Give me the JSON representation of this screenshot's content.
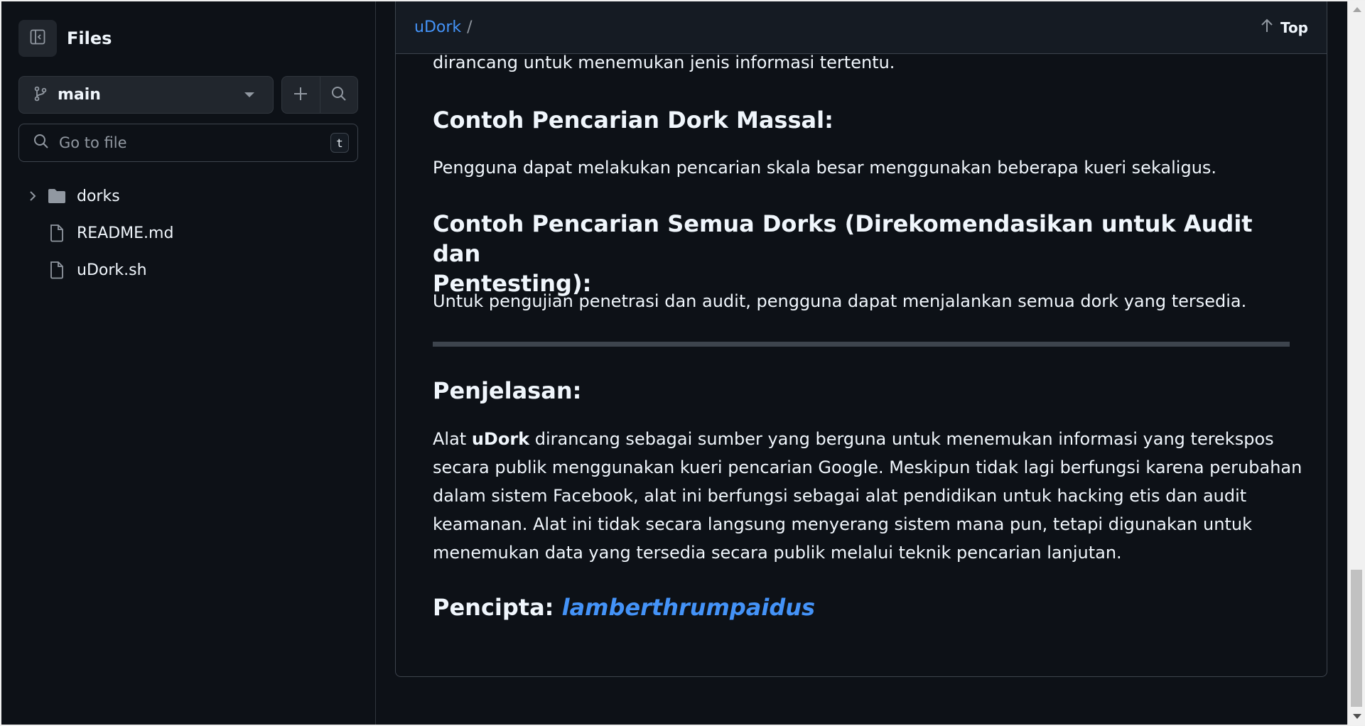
{
  "sidebar": {
    "title": "Files",
    "branch": "main",
    "search_placeholder": "Go to file",
    "search_shortcut": "t",
    "tree": [
      {
        "type": "folder",
        "name": "dorks"
      },
      {
        "type": "file",
        "name": "README.md"
      },
      {
        "type": "file",
        "name": "uDork.sh"
      }
    ]
  },
  "header": {
    "breadcrumb_repo": "uDork",
    "breadcrumb_sep": "/",
    "top_label": "Top"
  },
  "content": {
    "intro_tail": "dirancang untuk menemukan jenis informasi tertentu.",
    "section1_title": "Contoh Pencarian Dork Massal:",
    "section1_text": "Pengguna dapat melakukan pencarian skala besar menggunakan beberapa kueri sekaligus.",
    "section2_title_line1": "Contoh Pencarian Semua Dorks (Direkomendasikan untuk Audit dan",
    "section2_title_line2": "Pentesting):",
    "section2_text": "Untuk pengujian penetrasi dan audit, pengguna dapat menjalankan semua dork yang tersedia.",
    "section3_title": "Penjelasan:",
    "para_prefix": "Alat ",
    "para_bold": "uDork",
    "para_line1_rest": " dirancang sebagai sumber yang berguna untuk menemukan informasi yang terekspos",
    "para_line2": "secara publik menggunakan kueri pencarian Google. Meskipun tidak lagi berfungsi karena perubahan",
    "para_line3": "dalam sistem Facebook, alat ini berfungsi sebagai alat pendidikan untuk hacking etis dan audit",
    "para_line4": "keamanan. Alat ini tidak secara langsung menyerang sistem mana pun, tetapi digunakan untuk",
    "para_line5": "menemukan data yang tersedia secara publik melalui teknik pencarian lanjutan.",
    "creator_label": "Pencipta: ",
    "creator_name": "lamberthrumpaidus"
  },
  "colors": {
    "background": "#0d1117",
    "link": "#4493f8",
    "border": "#3d444d"
  }
}
